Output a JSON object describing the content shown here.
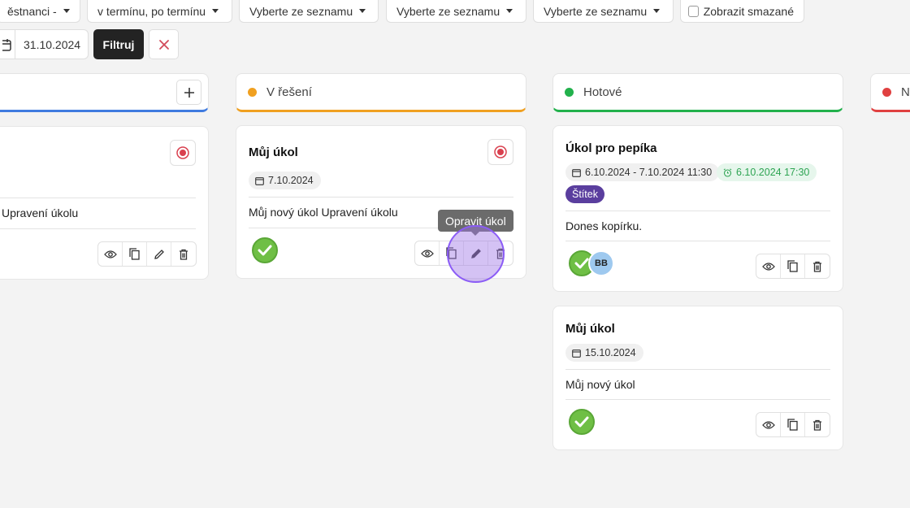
{
  "filters": {
    "employees": "ěstnanci -",
    "deadline": "v termínu, po termínu",
    "select1": "Vyberte ze seznamu",
    "select2": "Vyberte ze seznamu",
    "select3": "Vyberte ze seznamu",
    "show_deleted": "Zobrazit smazané",
    "date_to": "31.10.2024",
    "filter_button": "Filtruj"
  },
  "columns": [
    {
      "name": "",
      "color": "#3f7be0"
    },
    {
      "name": "V řešení",
      "color": "#f0a020"
    },
    {
      "name": "Hotové",
      "color": "#22b14c"
    },
    {
      "name": "N",
      "color": "#e04040"
    }
  ],
  "cards": {
    "col0_card": {
      "description": "l Upravení úkolu"
    },
    "col1_card": {
      "title": "Můj úkol",
      "date": "7.10.2024",
      "description": "Můj nový úkol Upravení úkolu"
    },
    "col2_card1": {
      "title": "Úkol pro pepíka",
      "date_range": "6.10.2024 - 7.10.2024 11:30",
      "reminder": "6.10.2024 17:30",
      "tag": "Štítek",
      "description": "Dones kopírku.",
      "avatar_initials": "BB"
    },
    "col2_card2": {
      "title": "Můj úkol",
      "date": "15.10.2024",
      "description": "Můj nový úkol"
    }
  },
  "tooltip": "Opravit úkol",
  "icons": [
    "calendar-icon",
    "close-icon",
    "plus-icon",
    "record-icon",
    "eye-icon",
    "copy-icon",
    "pencil-icon",
    "trash-icon",
    "check-icon",
    "alarm-icon"
  ]
}
